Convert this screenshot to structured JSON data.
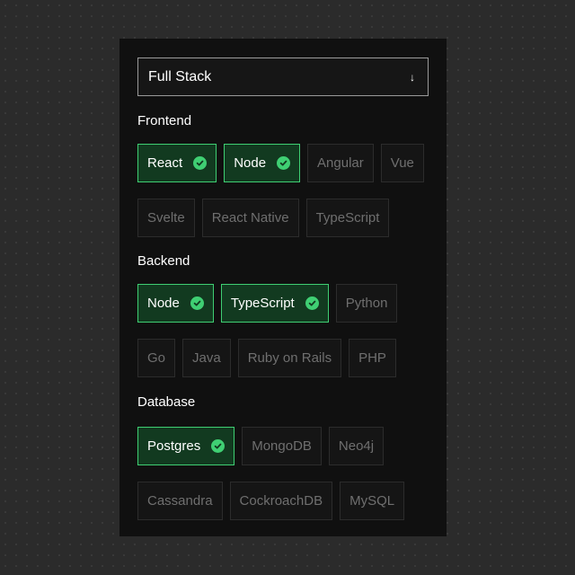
{
  "stack_select": {
    "value": "Full Stack",
    "arrow": "↓"
  },
  "sections": [
    {
      "title": "Frontend",
      "chips": [
        {
          "label": "React",
          "selected": true
        },
        {
          "label": "Node",
          "selected": true
        },
        {
          "label": "Angular",
          "selected": false
        },
        {
          "label": "Vue",
          "selected": false
        },
        {
          "label": "Svelte",
          "selected": false
        },
        {
          "label": "React Native",
          "selected": false
        },
        {
          "label": "TypeScript",
          "selected": false
        }
      ]
    },
    {
      "title": "Backend",
      "chips": [
        {
          "label": "Node",
          "selected": true
        },
        {
          "label": "TypeScript",
          "selected": true
        },
        {
          "label": "Python",
          "selected": false
        },
        {
          "label": "Go",
          "selected": false
        },
        {
          "label": "Java",
          "selected": false
        },
        {
          "label": "Ruby on Rails",
          "selected": false
        },
        {
          "label": "PHP",
          "selected": false
        }
      ]
    },
    {
      "title": "Database",
      "chips": [
        {
          "label": "Postgres",
          "selected": true
        },
        {
          "label": "MongoDB",
          "selected": false
        },
        {
          "label": "Neo4j",
          "selected": false
        },
        {
          "label": "Cassandra",
          "selected": false
        },
        {
          "label": "CockroachDB",
          "selected": false
        },
        {
          "label": "MySQL",
          "selected": false
        }
      ]
    }
  ],
  "colors": {
    "accent": "#3fcf73",
    "selected_bg": "#123a20",
    "panel_bg": "#101010",
    "page_bg": "#2b2b2b"
  },
  "icons": {
    "selected_marker": "check-circle-icon",
    "select_marker": "arrow-down-icon"
  }
}
